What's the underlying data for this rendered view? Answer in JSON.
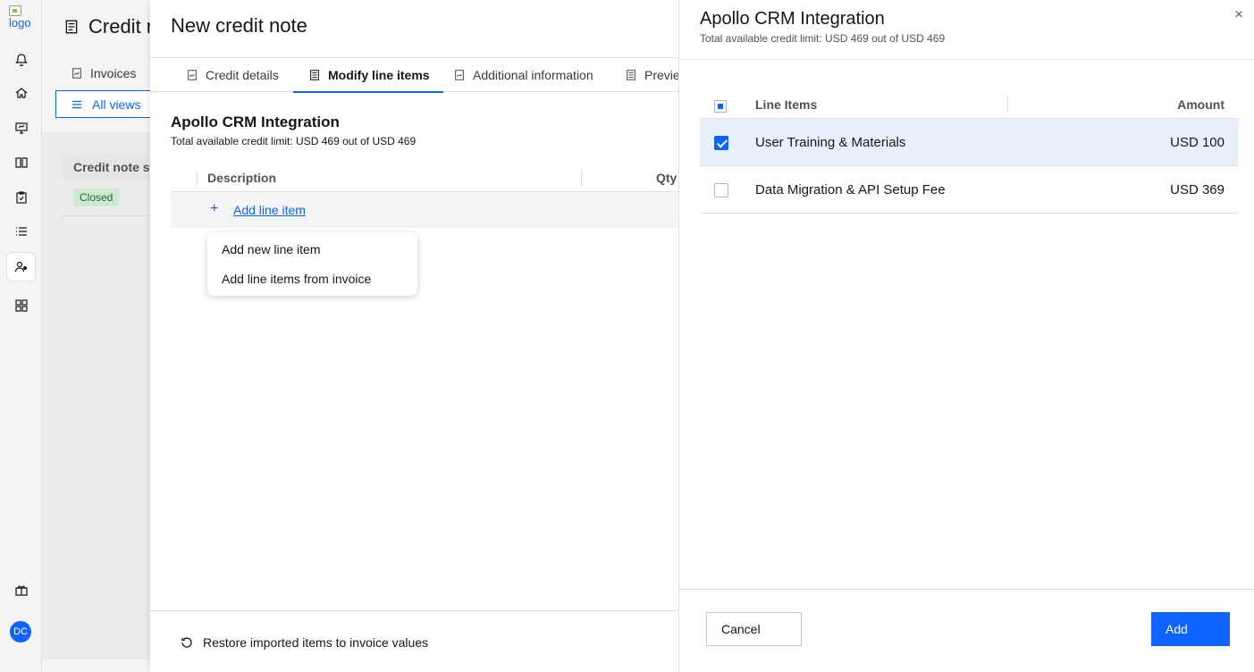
{
  "rail": {
    "logo_text": "logo",
    "avatar_initials": "DC",
    "icons": [
      "bell-icon",
      "home-icon",
      "monitor-icon",
      "book-icon",
      "clipboard-icon",
      "list-icon",
      "user-group-icon",
      "apps-icon",
      "gift-icon"
    ]
  },
  "background_page": {
    "title": "Credit notes",
    "tab_invoices": "Invoices",
    "all_views": "All views",
    "column_header": "Credit note status",
    "status_badge": "Closed"
  },
  "modal": {
    "title": "New credit note",
    "tabs": [
      {
        "label": "Credit details",
        "active": false
      },
      {
        "label": "Modify line items",
        "active": true
      },
      {
        "label": "Additional information",
        "active": false
      },
      {
        "label": "Preview",
        "active": false
      }
    ],
    "section_title": "Apollo CRM Integration",
    "section_subtitle": "Total available credit limit: USD 469 out of USD 469",
    "table_headers": {
      "description": "Description",
      "qty": "Qty"
    },
    "add_line_item": "Add line item",
    "menu": [
      "Add new line item",
      "Add line items from invoice"
    ],
    "restore_label": "Restore imported items to invoice values"
  },
  "panel": {
    "title": "Apollo CRM Integration",
    "subtitle": "Total available credit limit: USD 469 out of USD 469",
    "headers": {
      "line_items": "Line Items",
      "amount": "Amount"
    },
    "rows": [
      {
        "name": "User Training & Materials",
        "amount": "USD 100",
        "checked": true
      },
      {
        "name": "Data Migration & API Setup Fee",
        "amount": "USD 369",
        "checked": false
      }
    ],
    "cancel_label": "Cancel",
    "add_label": "Add"
  },
  "colors": {
    "accent": "#0f62fe",
    "selected_row": "#e8f0fe",
    "badge_bg": "#cde9d3",
    "badge_text": "#1e6b36"
  }
}
